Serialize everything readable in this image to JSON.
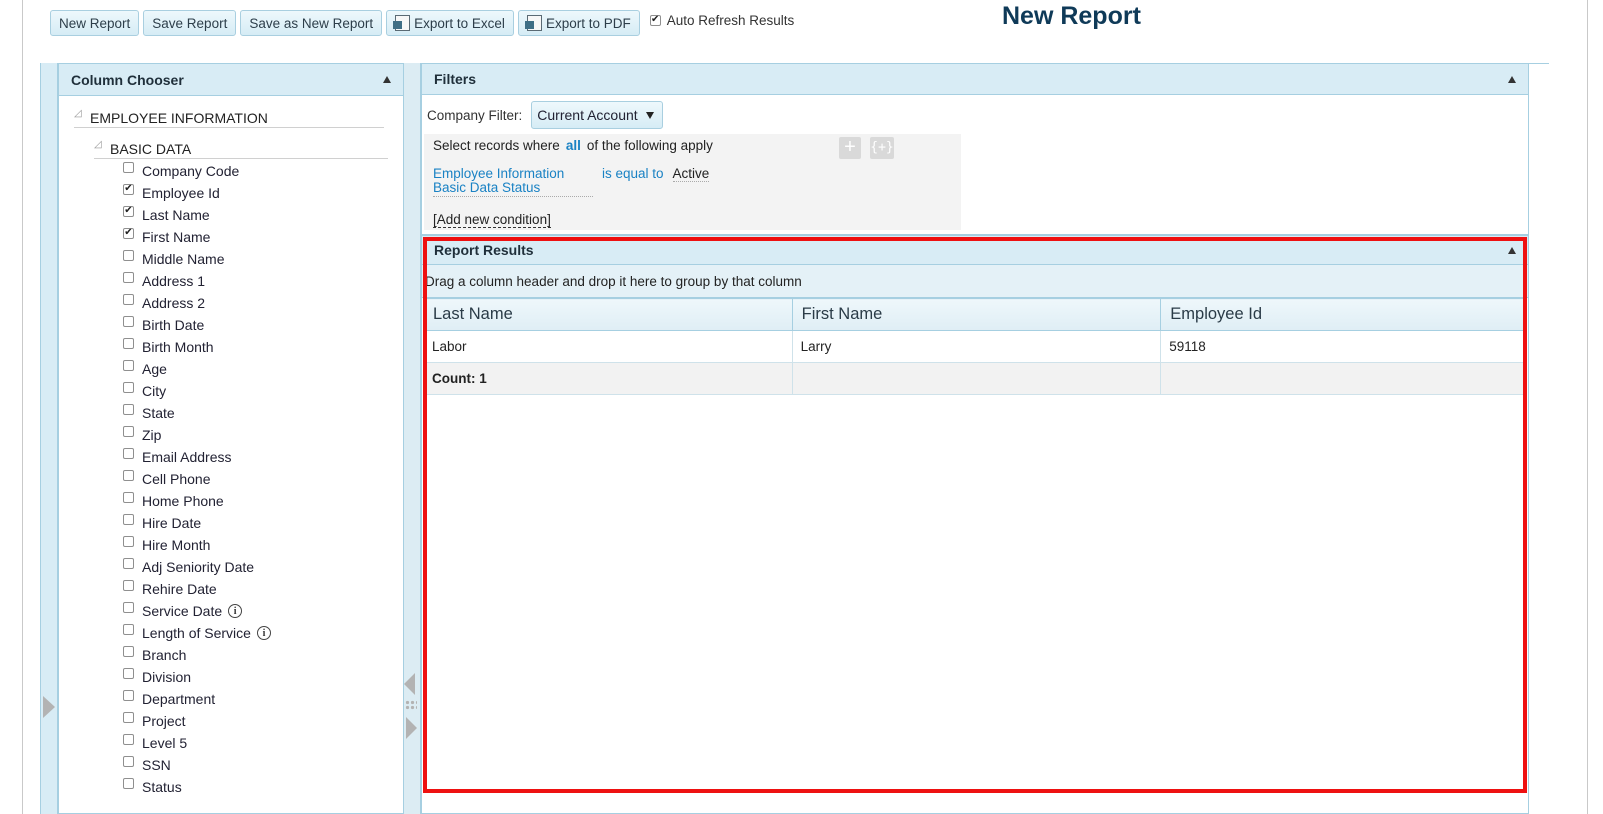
{
  "toolbar": {
    "new_report": "New Report",
    "save_report": "Save Report",
    "save_as_new": "Save as New Report",
    "export_excel": "Export to Excel",
    "export_pdf": "Export to PDF",
    "auto_refresh": "Auto Refresh Results",
    "auto_refresh_checked": true
  },
  "page_title": "New Report",
  "column_chooser": {
    "title": "Column Chooser",
    "root": "EMPLOYEE INFORMATION",
    "section": "BASIC DATA",
    "fields": [
      {
        "label": "Company Code",
        "checked": false
      },
      {
        "label": "Employee Id",
        "checked": true
      },
      {
        "label": "Last Name",
        "checked": true
      },
      {
        "label": "First Name",
        "checked": true
      },
      {
        "label": "Middle Name",
        "checked": false
      },
      {
        "label": "Address 1",
        "checked": false
      },
      {
        "label": "Address 2",
        "checked": false
      },
      {
        "label": "Birth Date",
        "checked": false
      },
      {
        "label": "Birth Month",
        "checked": false
      },
      {
        "label": "Age",
        "checked": false
      },
      {
        "label": "City",
        "checked": false
      },
      {
        "label": "State",
        "checked": false
      },
      {
        "label": "Zip",
        "checked": false
      },
      {
        "label": "Email Address",
        "checked": false
      },
      {
        "label": "Cell Phone",
        "checked": false
      },
      {
        "label": "Home Phone",
        "checked": false
      },
      {
        "label": "Hire Date",
        "checked": false
      },
      {
        "label": "Hire Month",
        "checked": false
      },
      {
        "label": "Adj Seniority Date",
        "checked": false
      },
      {
        "label": "Rehire Date",
        "checked": false
      },
      {
        "label": "Service Date",
        "checked": false,
        "info": true
      },
      {
        "label": "Length of Service",
        "checked": false,
        "info": true
      },
      {
        "label": "Branch",
        "checked": false
      },
      {
        "label": "Division",
        "checked": false
      },
      {
        "label": "Department",
        "checked": false
      },
      {
        "label": "Project",
        "checked": false
      },
      {
        "label": "Level 5",
        "checked": false
      },
      {
        "label": "SSN",
        "checked": false
      },
      {
        "label": "Status",
        "checked": false
      }
    ]
  },
  "filters": {
    "title": "Filters",
    "company_label": "Company Filter:",
    "company_value": "Current Account",
    "select_prefix": "Select records where",
    "select_all": "all",
    "select_suffix": "of the following apply",
    "plus_symbol": "+",
    "group_symbol": "{+}",
    "condition": {
      "field": "Employee Information Basic Data Status",
      "operator": "is equal to",
      "value": "Active"
    },
    "add_condition": "[Add new condition]"
  },
  "results": {
    "title": "Report Results",
    "group_hint": "Drag a column header and drop it here to group by that column",
    "columns": [
      "Last Name",
      "First Name",
      "Employee Id"
    ],
    "rows": [
      [
        "Labor",
        "Larry",
        "59118"
      ]
    ],
    "footer": "Count: 1"
  },
  "colors": {
    "accent": "#1a82c4",
    "header_bg": "#d8ecf5",
    "highlight": "#ee1111",
    "title": "#0f3a58"
  }
}
